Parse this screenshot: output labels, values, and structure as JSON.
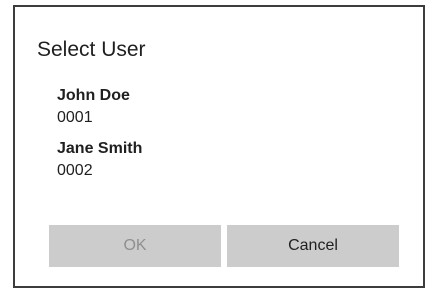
{
  "dialog": {
    "title": "Select User",
    "users": [
      {
        "name": "John Doe",
        "id": "0001"
      },
      {
        "name": "Jane Smith",
        "id": "0002"
      }
    ],
    "buttons": {
      "ok_label": "OK",
      "ok_enabled": false,
      "cancel_label": "Cancel"
    }
  },
  "colors": {
    "border": "#3c3c3c",
    "button_bg": "#cccccc",
    "disabled_text": "#8f8f8f",
    "text": "#1f1f1f"
  }
}
